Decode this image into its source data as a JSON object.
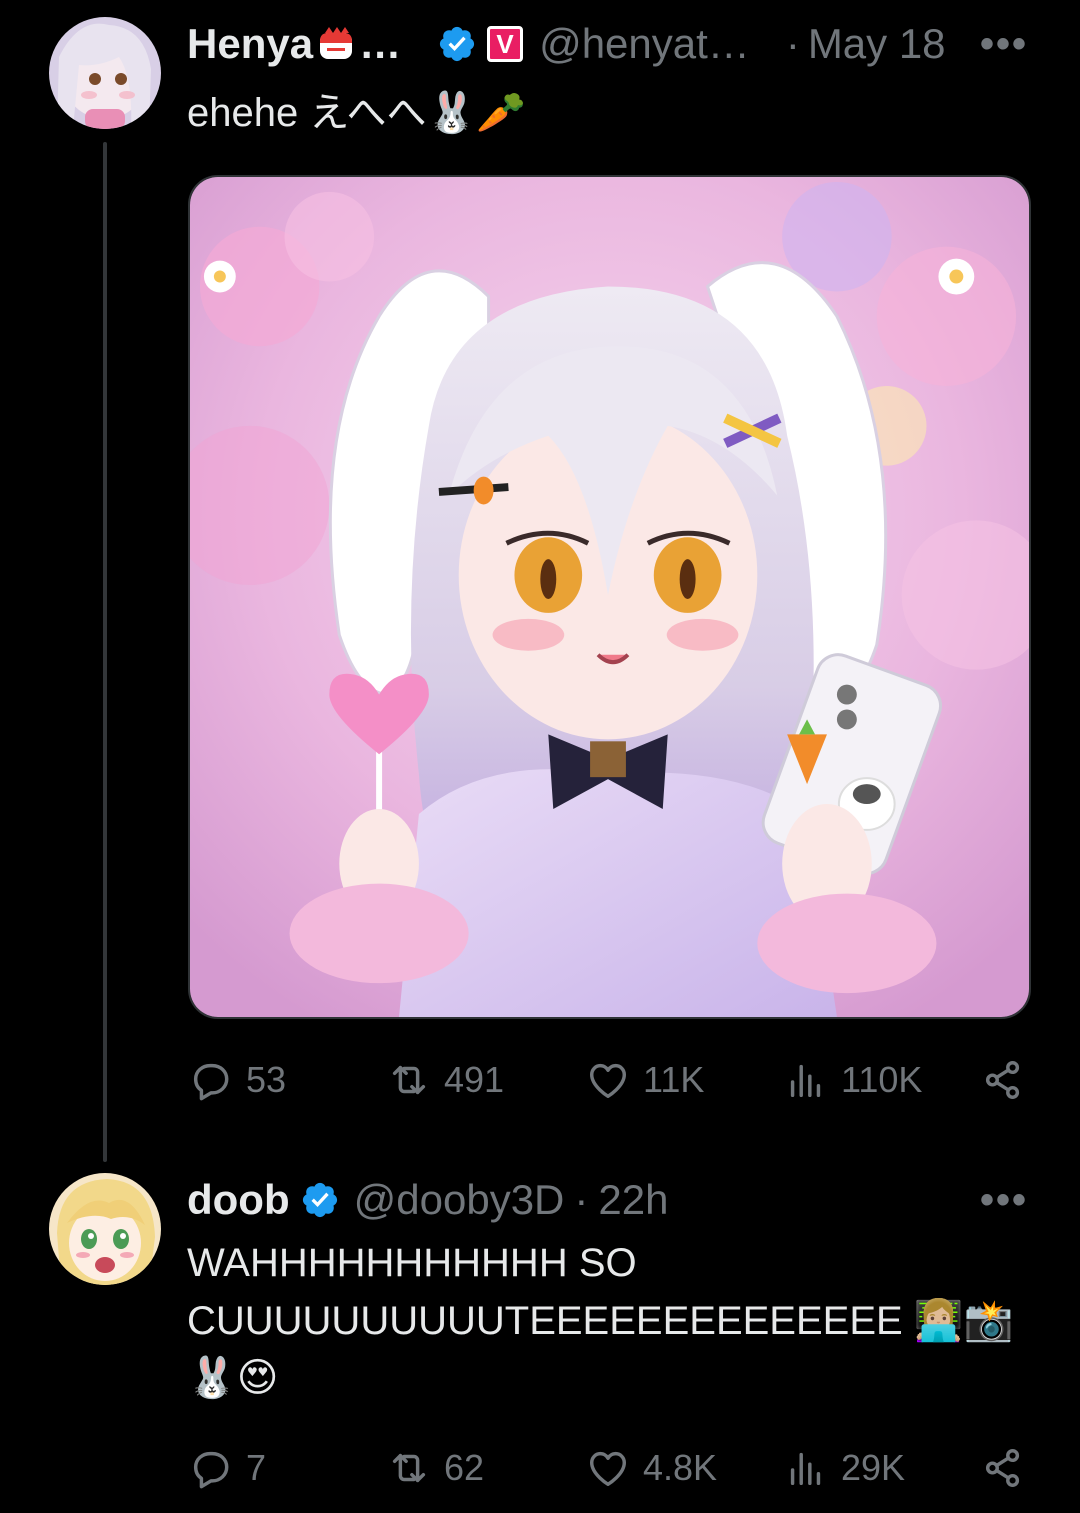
{
  "post1": {
    "display_name": "Henya",
    "name_ellipsis": "…",
    "affiliate_badge_label": "V",
    "handle": "@henyat…",
    "separator": "·",
    "date": "May 18",
    "more_label": "•••",
    "text": "ehehe えへへ🐰🥕",
    "stats": {
      "replies": "53",
      "reposts": "491",
      "likes": "11K",
      "views": "110K"
    }
  },
  "post2": {
    "display_name": "doob",
    "handle": "@dooby3D",
    "separator": "·",
    "time": "22h",
    "more_label": "•••",
    "text_line1": "WAHHHHHHHHHHH SO",
    "text_line2": "CUUUUUUUUUUTEEEEEEEEEEEEEE 👩🏼‍💻📸",
    "text_line3": "🐰😍",
    "stats": {
      "replies": "7",
      "reposts": "62",
      "likes": "4.8K",
      "views": "29K"
    }
  },
  "colors": {
    "background": "#000000",
    "text_primary": "#e7e9ea",
    "text_secondary": "#71767b",
    "verified_blue": "#1d9bf0",
    "affiliate_pink": "#e91e63",
    "thread_line": "#333639"
  },
  "icons": [
    "reply-icon",
    "repost-icon",
    "like-icon",
    "views-icon",
    "share-icon",
    "verified-icon"
  ]
}
